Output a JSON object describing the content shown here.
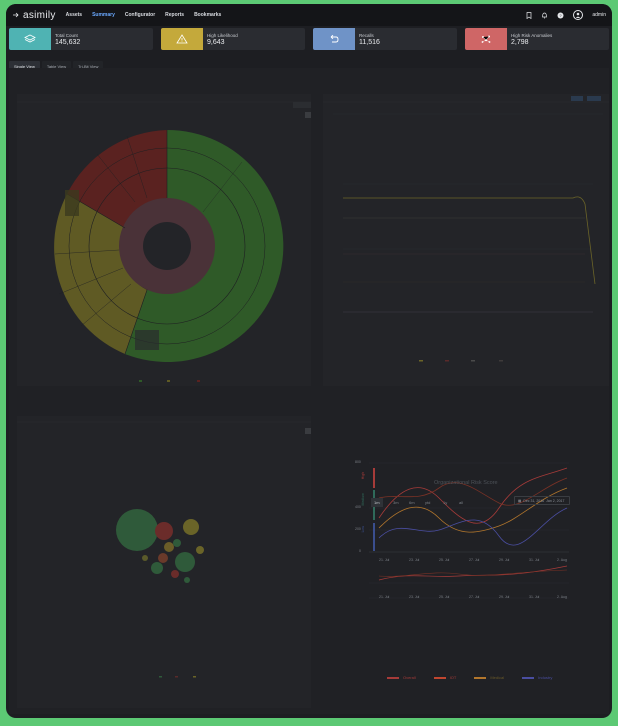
{
  "app": {
    "logo_text": "asimily",
    "nav": [
      {
        "label": "Assets",
        "active": false
      },
      {
        "label": "Summary",
        "active": true
      },
      {
        "label": "Configurator",
        "active": false
      },
      {
        "label": "Reports",
        "active": false
      },
      {
        "label": "Bookmarks",
        "active": false
      }
    ],
    "user": "admin"
  },
  "cards": [
    {
      "label": "Total Count",
      "value": "145,632",
      "icon": "layers-icon",
      "color": "#4fb3b3"
    },
    {
      "label": "High Likelihood",
      "value": "9,643",
      "icon": "warning-icon",
      "color": "#c4a93b"
    },
    {
      "label": "Recalls",
      "value": "11,516",
      "icon": "undo-icon",
      "color": "#6f93c7"
    },
    {
      "label": "High Risk Anomalies",
      "value": "2,798",
      "icon": "network-icon",
      "color": "#cf6666"
    }
  ],
  "view_tabs": [
    {
      "label": "Single View",
      "active": true
    },
    {
      "label": "Table View",
      "active": false
    },
    {
      "label": "Tri-Bit View",
      "active": false
    }
  ],
  "colors": {
    "green": "#2f5a28",
    "olive": "#5f5a24",
    "red": "#5a2220",
    "center": "#4a3238",
    "line_teal": "#42504a",
    "sunburst_red": "#5b2421"
  },
  "org_risk": {
    "title": "Organizational Risk Score",
    "ranges": [
      "1m",
      "3m",
      "6m",
      "ytd",
      "1y",
      "all"
    ],
    "active_range": "1m",
    "date_from": "Dec 31, 2016",
    "date_to": "Jan 2, 2017",
    "y_ticks": [
      "800",
      "400",
      "200",
      "0"
    ],
    "x_ticks": [
      "21. Jul",
      "23. Jul",
      "25. Jul",
      "27. Jul",
      "29. Jul",
      "31. Jul",
      "2. Aug"
    ],
    "nav_x_ticks": [
      "21. Jul",
      "23. Jul",
      "25. Jul",
      "27. Jul",
      "29. Jul",
      "31. Jul",
      "2. Aug"
    ],
    "side_labels": [
      "High",
      "Medium",
      "Low"
    ],
    "legend": [
      {
        "name": "Overall",
        "color": "#a63b39"
      },
      {
        "name": "IOT",
        "color": "#c0462f"
      },
      {
        "name": "Medical",
        "color": "#b2762c"
      },
      {
        "name": "Industry",
        "color": "#4a4ea1"
      }
    ]
  }
}
